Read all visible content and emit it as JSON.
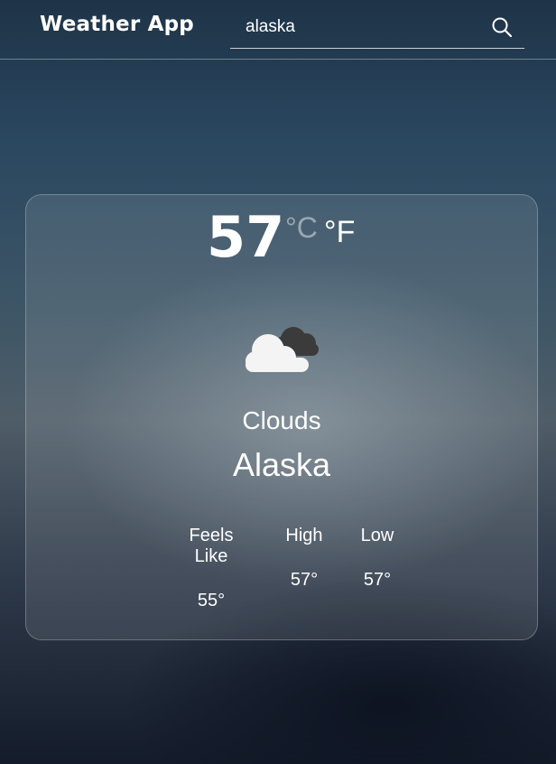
{
  "header": {
    "app_title": "Weather App"
  },
  "search": {
    "value": "alaska",
    "icon": "search-icon"
  },
  "weather": {
    "temperature": "57",
    "unit_celsius": "°C",
    "unit_fahrenheit": "°F",
    "active_unit": "F",
    "icon": "cloud-icon",
    "condition": "Clouds",
    "city": "Alaska",
    "stats": {
      "feels_like_label": "Feels Like",
      "feels_like_value": "55°",
      "high_label": "High",
      "high_value": "57°",
      "low_label": "Low",
      "low_value": "57°"
    }
  },
  "colors": {
    "text": "#ffffff",
    "inactive_unit": "#ffffff73",
    "card_background": "#ffffff1a"
  }
}
